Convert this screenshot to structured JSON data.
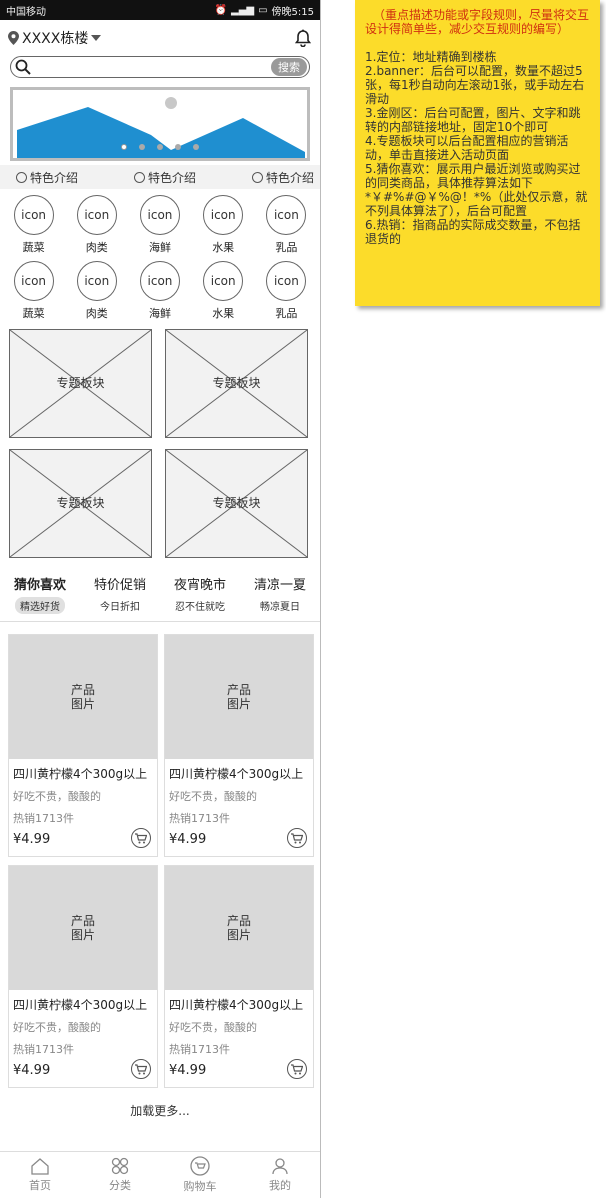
{
  "statusbar": {
    "carrier": "中国移动",
    "time": "傍晚5:15"
  },
  "header": {
    "location": "XXXX栋楼"
  },
  "search": {
    "placeholder": "",
    "button": "搜索"
  },
  "features": [
    "特色介绍",
    "特色介绍",
    "特色介绍"
  ],
  "categories": [
    {
      "icon": "icon",
      "label": "蔬菜"
    },
    {
      "icon": "icon",
      "label": "肉类"
    },
    {
      "icon": "icon",
      "label": "海鲜"
    },
    {
      "icon": "icon",
      "label": "水果"
    },
    {
      "icon": "icon",
      "label": "乳品"
    },
    {
      "icon": "icon",
      "label": "蔬菜"
    },
    {
      "icon": "icon",
      "label": "肉类"
    },
    {
      "icon": "icon",
      "label": "海鲜"
    },
    {
      "icon": "icon",
      "label": "水果"
    },
    {
      "icon": "icon",
      "label": "乳品"
    }
  ],
  "topics": [
    "专题板块",
    "专题板块",
    "专题板块",
    "专题板块"
  ],
  "tabs": [
    {
      "title": "猜你喜欢",
      "sub": "精选好货"
    },
    {
      "title": "特价促销",
      "sub": "今日折扣"
    },
    {
      "title": "夜宵晚市",
      "sub": "忍不住就吃"
    },
    {
      "title": "清凉一夏",
      "sub": "畅凉夏日"
    }
  ],
  "products": [
    {
      "image": "产品\n图片",
      "name": "四川黄柠檬4个300g以上",
      "desc": "好吃不贵，酸酸的",
      "sold": "热销1713件",
      "price": "¥4.99"
    },
    {
      "image": "产品\n图片",
      "name": "四川黄柠檬4个300g以上",
      "desc": "好吃不贵，酸酸的",
      "sold": "热销1713件",
      "price": "¥4.99"
    },
    {
      "image": "产品\n图片",
      "name": "四川黄柠檬4个300g以上",
      "desc": "好吃不贵，酸酸的",
      "sold": "热销1713件",
      "price": "¥4.99"
    },
    {
      "image": "产品\n图片",
      "name": "四川黄柠檬4个300g以上",
      "desc": "好吃不贵，酸酸的",
      "sold": "热销1713件",
      "price": "¥4.99"
    }
  ],
  "load_more": "加载更多...",
  "nav": [
    "首页",
    "分类",
    "购物车",
    "我的"
  ],
  "note": {
    "headline": "（重点描述功能或字段规则，尽量将交互设计得简单些，减少交互规则的编写）",
    "items": [
      "1.定位：地址精确到楼栋",
      "2.banner：后台可以配置，数量不超过5张，每1秒自动向左滚动1张，或手动左右滑动",
      "3.金刚区：后台可配置，图片、文字和跳转的内部链接地址，固定10个即可",
      "4.专题板块可以后台配置相应的营销活动，单击直接进入活动页面",
      "5.猜你喜欢：展示用户最近浏览或购买过的同类商品，具体推荐算法如下*￥#%#@￥%@！*%（此处仅示意，就不列具体算法了），后台可配置",
      "6.热销：指商品的实际成交数量，不包括退货的"
    ]
  },
  "colors": {
    "banner_mountain": "#1f8fd0",
    "note_bg": "#fcdc2a",
    "note_headline": "#d03010"
  }
}
